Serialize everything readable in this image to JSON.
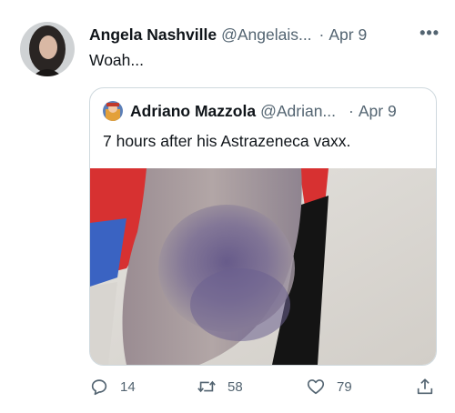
{
  "tweet": {
    "author_name": "Angela Nashville",
    "author_handle": "@Angelais...",
    "separator": "·",
    "date": "Apr 9",
    "more_label": "•••",
    "text": "Woah..."
  },
  "quoted_tweet": {
    "author_name": "Adriano Mazzola",
    "author_handle": "@Adrian...",
    "separator": "·",
    "date": "Apr 9",
    "text": "7 hours after his Astrazeneca vaxx."
  },
  "actions": {
    "reply_count": "14",
    "retweet_count": "58",
    "like_count": "79"
  },
  "icons": {
    "reply": "reply-icon",
    "retweet": "retweet-icon",
    "like": "heart-icon",
    "share": "share-icon",
    "more": "more-icon"
  },
  "colors": {
    "text_primary": "#0f1419",
    "text_secondary": "#536471",
    "border": "#cfd9de"
  }
}
